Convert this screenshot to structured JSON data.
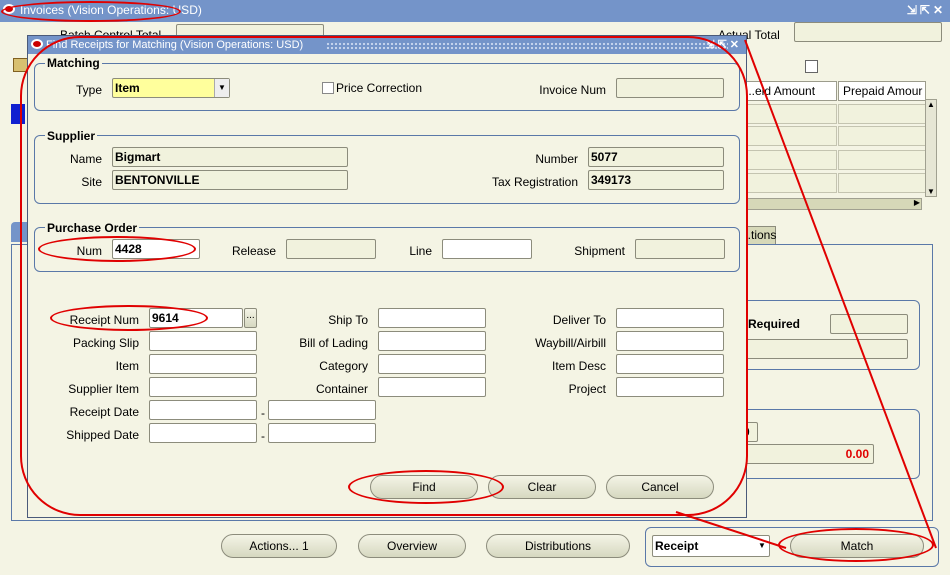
{
  "main_window": {
    "title": "Invoices (Vision Operations: USD)",
    "batch_control_total_label": "Batch Control Total",
    "actual_total_label": "Actual Total",
    "columns": [
      "...eld Amount",
      "Prepaid Amour"
    ],
    "tab_partial": "...tions",
    "required_label": "Required",
    "partial_zero": "0",
    "amount_value": "0.00"
  },
  "dialog": {
    "title": "Find Receipts for Matching (Vision Operations: USD)",
    "matching": {
      "group_title": "Matching",
      "type_label": "Type",
      "type_value": "Item",
      "price_correction_label": "Price Correction",
      "invoice_num_label": "Invoice Num",
      "invoice_num_value": ""
    },
    "supplier": {
      "group_title": "Supplier",
      "name_label": "Name",
      "name_value": "Bigmart",
      "site_label": "Site",
      "site_value": "BENTONVILLE",
      "number_label": "Number",
      "number_value": "5077",
      "tax_label": "Tax Registration",
      "tax_value": "349173"
    },
    "purchase_order": {
      "group_title": "Purchase Order",
      "num_label": "Num",
      "num_value": "4428",
      "release_label": "Release",
      "line_label": "Line",
      "shipment_label": "Shipment"
    },
    "receipt": {
      "receipt_num_label": "Receipt Num",
      "receipt_num_value": "9614",
      "lov_button": "...",
      "packing_slip_label": "Packing Slip",
      "item_label": "Item",
      "supplier_item_label": "Supplier Item",
      "receipt_date_label": "Receipt Date",
      "shipped_date_label": "Shipped Date",
      "date_sep": "-",
      "ship_to_label": "Ship To",
      "bill_of_lading_label": "Bill of Lading",
      "category_label": "Category",
      "container_label": "Container",
      "deliver_to_label": "Deliver To",
      "waybill_label": "Waybill/Airbill",
      "item_desc_label": "Item Desc",
      "project_label": "Project"
    },
    "buttons": {
      "find": "Find",
      "clear": "Clear",
      "cancel": "Cancel"
    }
  },
  "bottom": {
    "actions_button": "Actions... 1",
    "overview_button": "Overview",
    "distributions_button": "Distributions",
    "match_type_value": "Receipt",
    "match_button": "Match"
  },
  "colors": {
    "titlebar": "#7494c9",
    "background": "#f4f4e4",
    "required_field": "#ffff9c",
    "annotation_red": "#e00000"
  }
}
